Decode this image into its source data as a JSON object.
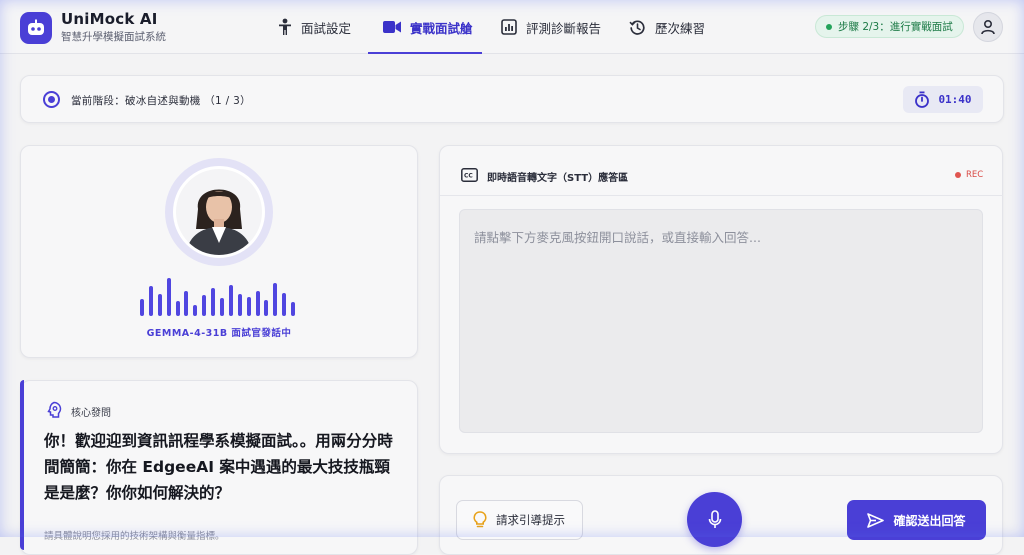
{
  "colors": {
    "accent": "#4a3fd6",
    "success": "#23a35a",
    "record": "#e05550"
  },
  "header": {
    "brand_title": "UniMock AI",
    "brand_subtitle": "智慧升學模擬面試系統",
    "logo_icon": "robot-icon",
    "nav": [
      {
        "label": "面試設定",
        "icon": "person-icon",
        "active": false
      },
      {
        "label": "實戰面試艙",
        "icon": "video-camera-icon",
        "active": true
      },
      {
        "label": "評測診斷報告",
        "icon": "chart-icon",
        "active": false
      },
      {
        "label": "歷次練習",
        "icon": "history-icon",
        "active": false
      }
    ],
    "step_badge": "步驟 2/3：進行實戰面試",
    "user_icon": "user-icon"
  },
  "phase": {
    "text": "當前階段：破冰自述與動機 （1 / 3）",
    "timer": "01:40",
    "timer_icon": "stopwatch-icon"
  },
  "interviewer": {
    "speaker_label": "GEMMA-4-31B 面試官發話中",
    "waveform_levels": [
      0.42,
      0.75,
      0.55,
      0.95,
      0.38,
      0.62,
      0.28,
      0.52,
      0.7,
      0.45,
      0.78,
      0.55,
      0.48,
      0.62,
      0.4,
      0.82,
      0.58,
      0.34
    ]
  },
  "question": {
    "label": "核心發問",
    "text": "你！歡迎迎到資訊訊程學系模擬面試。。用兩分分時間簡簡：你在 EdgeeAI 案中遇遇的最大技技瓶頸是是麼？你你如何解決的？",
    "hint": "請具體說明您採用的技術架構與衡量指標。"
  },
  "stt": {
    "title": "即時語音轉文字（STT）應答區",
    "rec": "REC",
    "placeholder": "請點擊下方麥克風按鈕開口說話，或直接輸入回答..."
  },
  "actions": {
    "hint_label": "請求引導提示",
    "submit_label": "確認送出回答"
  }
}
